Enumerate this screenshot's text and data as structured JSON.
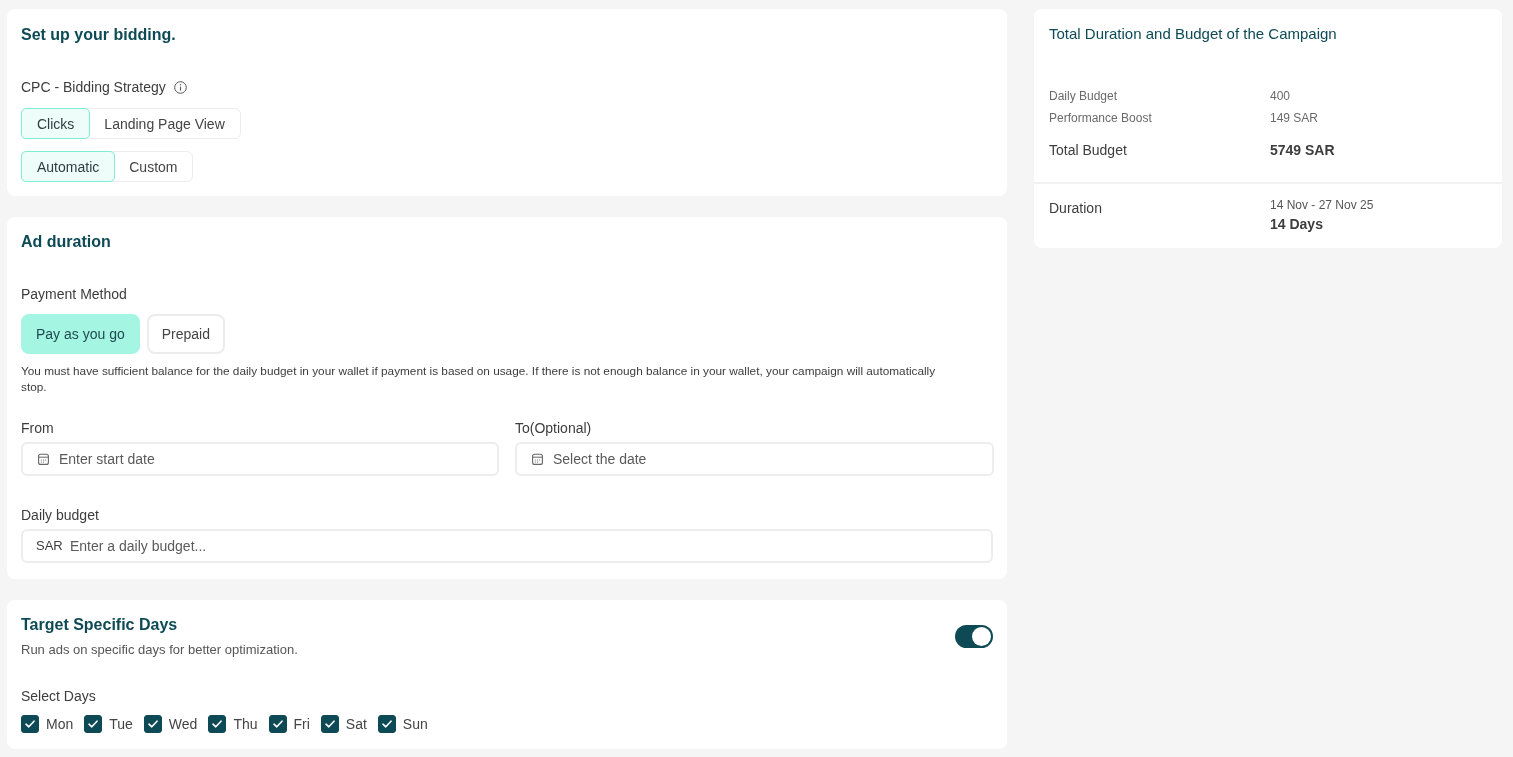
{
  "bidding": {
    "title": "Set up your bidding.",
    "strategy_label": "CPC - Bidding Strategy",
    "goal_options": [
      {
        "label": "Clicks",
        "selected": true
      },
      {
        "label": "Landing Page View",
        "selected": false
      }
    ],
    "mode_options": [
      {
        "label": "Automatic",
        "selected": true
      },
      {
        "label": "Custom",
        "selected": false
      }
    ]
  },
  "ad_duration": {
    "title": "Ad duration",
    "payment_label": "Payment Method",
    "payment_options": [
      {
        "label": "Pay as you go",
        "selected": true
      },
      {
        "label": "Prepaid",
        "selected": false
      }
    ],
    "note": "You must have sufficient balance for the daily budget in your wallet if payment is based on usage. If there is not enough balance in your wallet, your campaign will automatically stop.",
    "from": {
      "label": "From",
      "placeholder": "Enter start date"
    },
    "to": {
      "label": "To(Optional)",
      "placeholder": "Select the date"
    },
    "daily_budget": {
      "label": "Daily budget",
      "prefix": "SAR",
      "placeholder": "Enter a daily budget..."
    }
  },
  "target_days": {
    "title": "Target Specific Days",
    "subtitle": "Run ads on specific days for better optimization.",
    "on": true,
    "select_label": "Select Days",
    "days": [
      {
        "label": "Mon",
        "checked": true
      },
      {
        "label": "Tue",
        "checked": true
      },
      {
        "label": "Wed",
        "checked": true
      },
      {
        "label": "Thu",
        "checked": true
      },
      {
        "label": "Fri",
        "checked": true
      },
      {
        "label": "Sat",
        "checked": true
      },
      {
        "label": "Sun",
        "checked": true
      }
    ]
  },
  "summary": {
    "title": "Total Duration and Budget of the Campaign",
    "budget_rows": [
      {
        "kind": "minor",
        "label": "Daily Budget",
        "value": "400"
      },
      {
        "kind": "minor",
        "label": "Performance Boost",
        "value": "149 SAR"
      },
      {
        "kind": "total",
        "label": "Total Budget",
        "value": "5749 SAR"
      }
    ],
    "duration": {
      "label": "Duration",
      "dates": "14 Nov - 27 Nov 25",
      "days": "14 Days"
    }
  }
}
